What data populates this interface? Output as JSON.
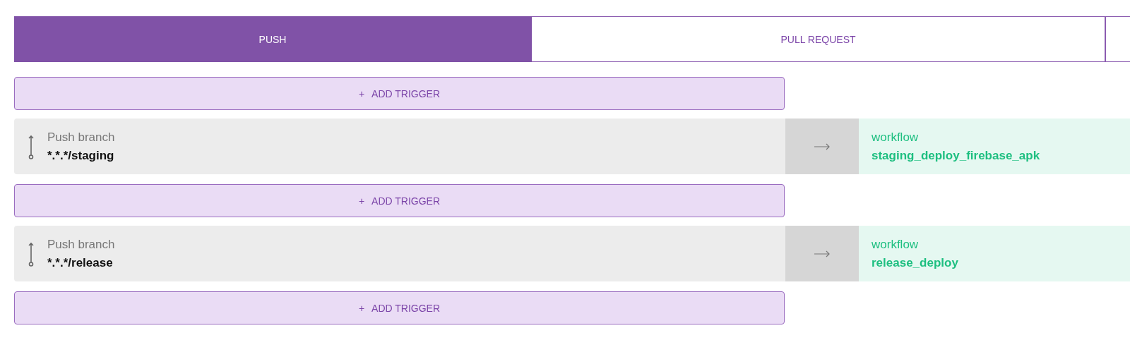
{
  "tabs": [
    {
      "label": "PUSH",
      "selected": true
    },
    {
      "label": "PULL REQUEST",
      "selected": false
    }
  ],
  "add_triggers": [
    {
      "plus": "+",
      "label": "ADD TRIGGER"
    },
    {
      "plus": "+",
      "label": "ADD TRIGGER"
    },
    {
      "plus": "+",
      "label": "ADD TRIGGER"
    }
  ],
  "triggers": [
    {
      "type": "Push branch",
      "pattern": "*.*.*/staging",
      "workflow_label": "workflow",
      "workflow": "staging_deploy_firebase_apk"
    },
    {
      "type": "Push branch",
      "pattern": "*.*.*/release",
      "workflow_label": "workflow",
      "workflow": "release_deploy"
    }
  ]
}
